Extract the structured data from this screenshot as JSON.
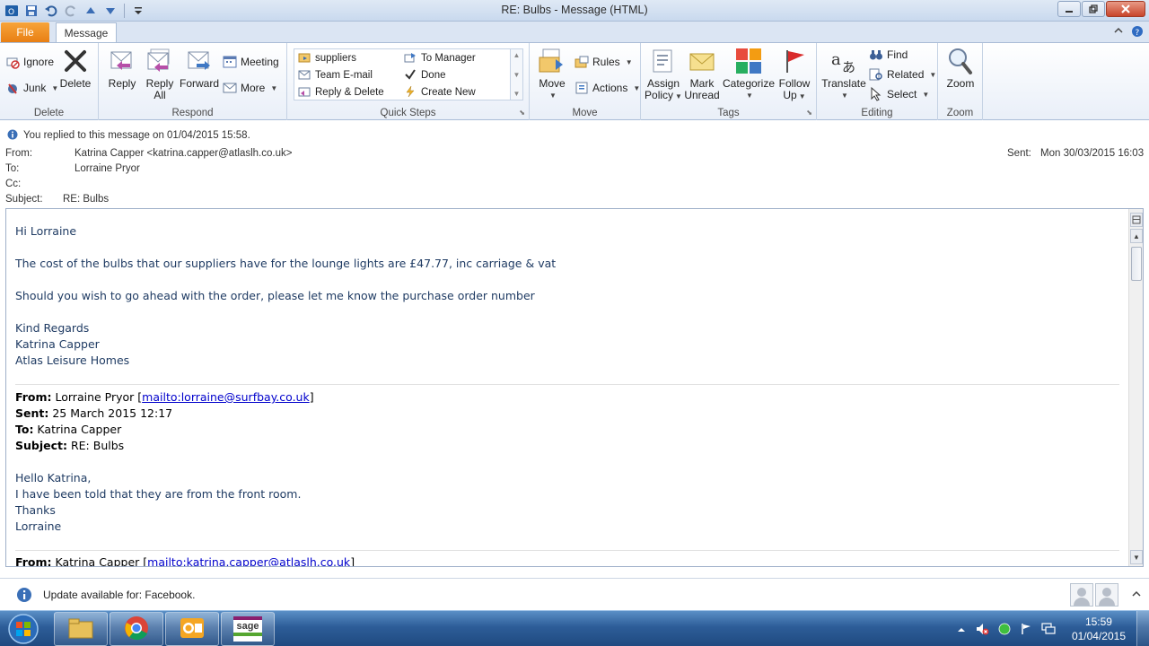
{
  "window": {
    "title": "RE: Bulbs  -  Message (HTML)"
  },
  "tabs": {
    "file": "File",
    "message": "Message"
  },
  "ribbon": {
    "delete_group": {
      "label": "Delete",
      "ignore": "Ignore",
      "junk": "Junk",
      "delete": "Delete"
    },
    "respond_group": {
      "label": "Respond",
      "reply": "Reply",
      "reply_all_1": "Reply",
      "reply_all_2": "All",
      "forward": "Forward",
      "meeting": "Meeting",
      "more": "More"
    },
    "quicksteps_group": {
      "label": "Quick Steps",
      "items": [
        "suppliers",
        "To Manager",
        "Team E-mail",
        "Done",
        "Reply & Delete",
        "Create New"
      ]
    },
    "move_group": {
      "label": "Move",
      "move": "Move",
      "rules": "Rules",
      "actions": "Actions"
    },
    "tags_group": {
      "label": "Tags",
      "assign_1": "Assign",
      "assign_2": "Policy",
      "mark_1": "Mark",
      "mark_2": "Unread",
      "categorize": "Categorize",
      "follow_1": "Follow",
      "follow_2": "Up"
    },
    "editing_group": {
      "label": "Editing",
      "translate": "Translate",
      "find": "Find",
      "related": "Related",
      "select": "Select"
    },
    "zoom_group": {
      "label": "Zoom",
      "zoom": "Zoom"
    }
  },
  "info": {
    "replied": "You replied to this message on 01/04/2015 15:58."
  },
  "headers": {
    "from_label": "From:",
    "from_value": "Katrina Capper <katrina.capper@atlaslh.co.uk>",
    "to_label": "To:",
    "to_value": "Lorraine Pryor",
    "cc_label": "Cc:",
    "subject_label": "Subject:",
    "subject_value": "RE: Bulbs",
    "sent_label": "Sent:",
    "sent_value": "Mon 30/03/2015 16:03"
  },
  "body": {
    "greeting": "Hi Lorraine",
    "p1": "The cost of the bulbs that our suppliers have for the lounge lights are £47.77, inc carriage & vat",
    "p2": "Should you wish to go ahead with the order, please let me know the purchase order number",
    "sig1": "Kind Regards",
    "sig2": "Katrina Capper",
    "sig3": "Atlas Leisure Homes",
    "q1_from_label": "From:",
    "q1_from_name": " Lorraine Pryor [",
    "q1_from_link": "mailto:lorraine@surfbay.co.uk",
    "q1_from_close": "]",
    "q1_sent_label": "Sent:",
    "q1_sent": " 25 March 2015 12:17",
    "q1_to_label": "To:",
    "q1_to": " Katrina Capper",
    "q1_subject_label": "Subject:",
    "q1_subject": " RE: Bulbs",
    "q1_l1": "Hello Katrina,",
    "q1_l2": "I have been told that they are from the front room.",
    "q1_l3": "Thanks",
    "q1_l4": "Lorraine",
    "q2_from_label": "From:",
    "q2_from_name": " Katrina Capper [",
    "q2_from_link": "mailto:katrina.capper@atlaslh.co.uk",
    "q2_from_close": "]"
  },
  "update_bar": {
    "text": "Update available for: Facebook."
  },
  "taskbar": {
    "time": "15:59",
    "date": "01/04/2015",
    "sage_label": "sage"
  },
  "colors": {
    "file_tab": "#e87f14",
    "body_text": "#1f3b63",
    "link": "#0000cc"
  }
}
